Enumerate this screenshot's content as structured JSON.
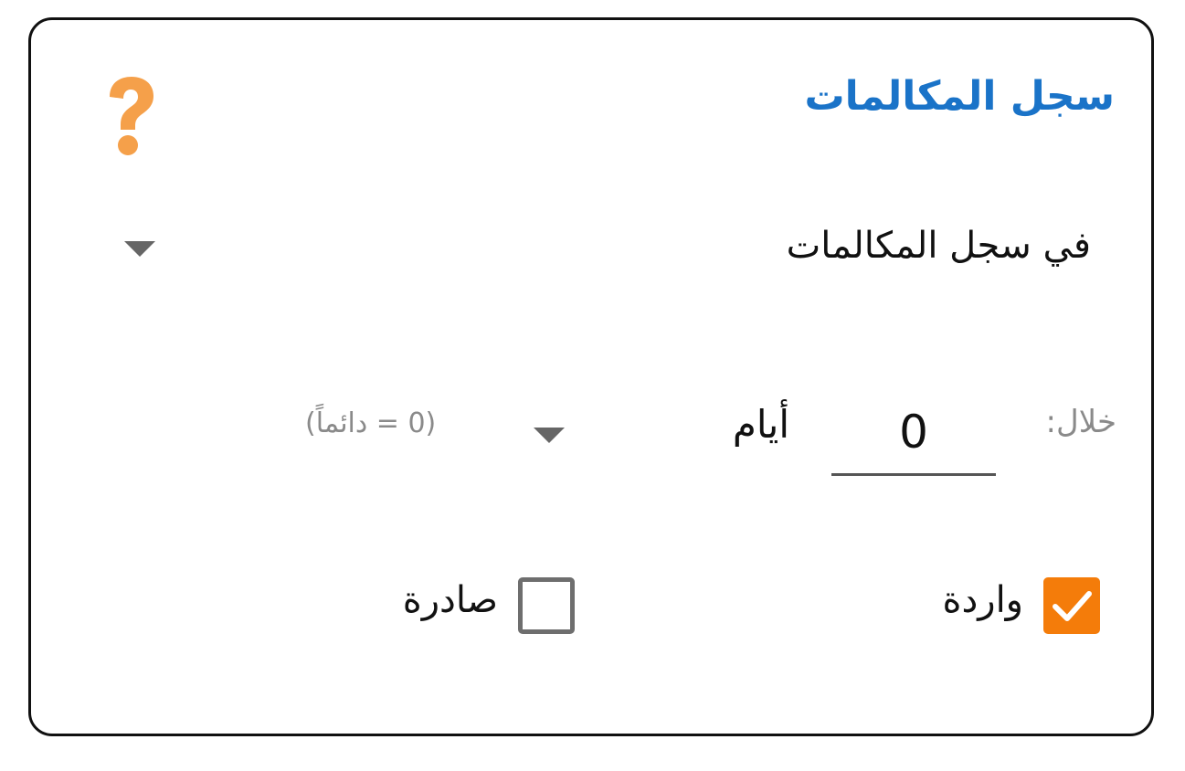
{
  "dialog": {
    "title": "سجل المكالمات",
    "title_color": "#1a73c8",
    "help_icon": "question-mark-icon",
    "help_color": "#f5a04a"
  },
  "source": {
    "selected": "في سجل المكالمات",
    "icon": "chevron-down-icon"
  },
  "period": {
    "label": "خلال:",
    "value": "0",
    "unit_selected": "أيام",
    "hint": "(0 = دائماً)"
  },
  "directions": {
    "incoming": {
      "label": "واردة",
      "checked": true,
      "color": "#f47c0a"
    },
    "outgoing": {
      "label": "صادرة",
      "checked": false
    }
  }
}
